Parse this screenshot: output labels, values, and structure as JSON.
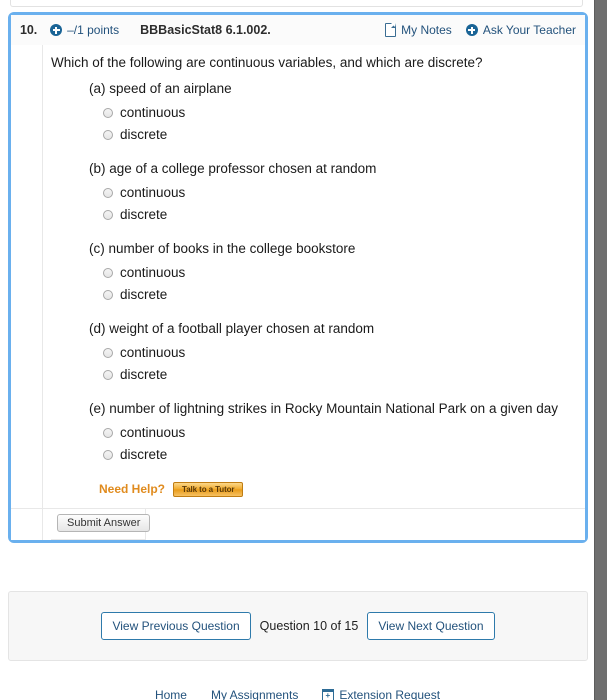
{
  "question": {
    "number": "10.",
    "points": "–/1 points",
    "code": "BBBasicStat8 6.1.002.",
    "my_notes_label": "My Notes",
    "ask_teacher_label": "Ask Your Teacher",
    "prompt": "Which of the following are continuous variables, and which are discrete?",
    "parts": [
      {
        "label": "(a) speed of an airplane",
        "choices": [
          "continuous",
          "discrete"
        ]
      },
      {
        "label": "(b) age of a college professor chosen at random",
        "choices": [
          "continuous",
          "discrete"
        ]
      },
      {
        "label": "(c) number of books in the college bookstore",
        "choices": [
          "continuous",
          "discrete"
        ]
      },
      {
        "label": "(d) weight of a football player chosen at random",
        "choices": [
          "continuous",
          "discrete"
        ]
      },
      {
        "label": "(e) number of lightning strikes in Rocky Mountain National Park on a given day",
        "choices": [
          "continuous",
          "discrete"
        ]
      }
    ],
    "need_help_label": "Need Help?",
    "tutor_button_label": "Talk to a Tutor",
    "submit_label": "Submit Answer"
  },
  "navigation": {
    "previous_label": "View Previous Question",
    "counter": "Question 10 of 15",
    "next_label": "View Next Question"
  },
  "footer": {
    "links": [
      {
        "label": "Home"
      },
      {
        "label": "My Assignments"
      },
      {
        "label": "Extension Request"
      }
    ]
  },
  "colors": {
    "highlight_border": "#6ab0ee",
    "link_blue": "#23527c",
    "accent_orange": "#e08b1e",
    "icon_blue": "#1a6496"
  }
}
